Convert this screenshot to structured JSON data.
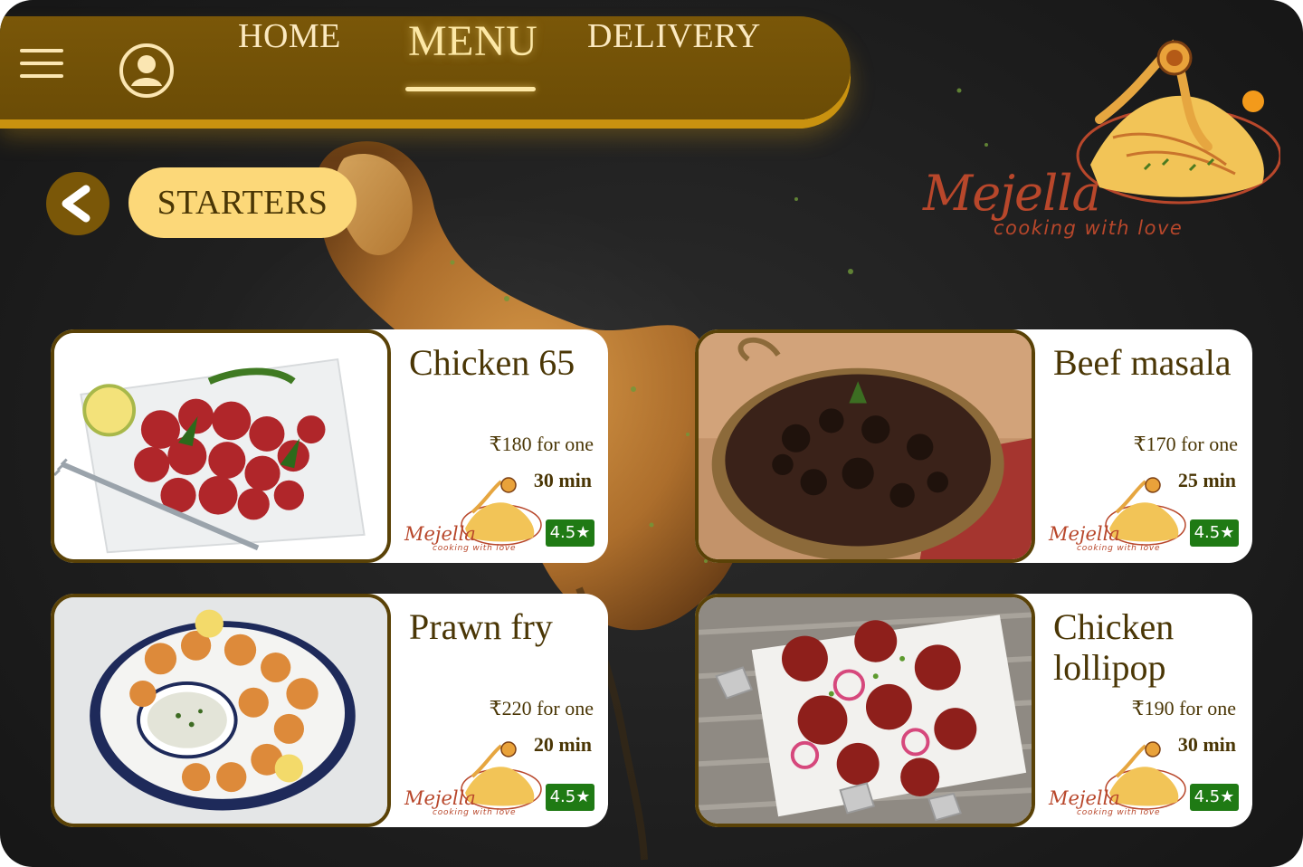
{
  "nav": {
    "home": "HOME",
    "menu": "MENU",
    "delivery": "DELIVERY",
    "active": "MENU"
  },
  "category": {
    "label": "STARTERS"
  },
  "brand": {
    "name": "Mejella",
    "tagline": "cooking with love"
  },
  "colors": {
    "nav_bg": "#6b4c06",
    "nav_glow": "#c9920f",
    "pill_bg": "#fcd879",
    "text_dark": "#4a3605",
    "brand_red": "#b8472b",
    "rating_green": "#1f7a14"
  },
  "items": [
    {
      "name": "Chicken 65",
      "price": "₹180 for one",
      "time": "30 min",
      "rating": "4.5★",
      "brand_name": "Mejella",
      "brand_tag": "cooking with love"
    },
    {
      "name": "Beef masala",
      "price": "₹170 for one",
      "time": "25 min",
      "rating": "4.5★",
      "brand_name": "Mejella",
      "brand_tag": "cooking with love"
    },
    {
      "name": "Prawn fry",
      "price": "₹220 for one",
      "time": "20 min",
      "rating": "4.5★",
      "brand_name": "Mejella",
      "brand_tag": "cooking with love"
    },
    {
      "name": "Chicken lollipop",
      "price": "₹190 for one",
      "time": "30 min",
      "rating": "4.5★",
      "brand_name": "Mejella",
      "brand_tag": "cooking with love"
    }
  ]
}
